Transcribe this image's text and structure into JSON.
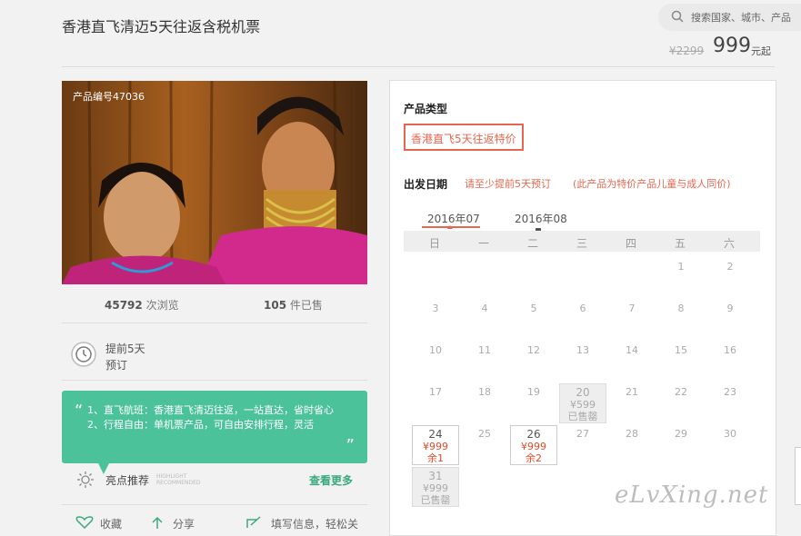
{
  "product": {
    "title": "香港直飞清迈5天往返含税机票",
    "old_price": "¥2299",
    "price": "999",
    "price_unit": "元起",
    "id_label": "产品编号47036"
  },
  "search": {
    "placeholder": "搜索国家、城市、产品"
  },
  "stats": {
    "views": "45792",
    "views_label": "次浏览",
    "sold": "105",
    "sold_label": "件已售"
  },
  "advance": {
    "line1": "提前5天",
    "line2": "预订"
  },
  "highlight": {
    "text1": "1、直飞航班：香港直飞清迈往返，一站直达，省时省心",
    "text2": "2、行程自由：单机票产品，可自由安排行程，灵活",
    "label": "亮点推荐",
    "label_en1": "HIGHLIGHT",
    "label_en2": "RECOMMENDED",
    "more": "查看更多"
  },
  "actions": [
    "收藏",
    "分享",
    "填写信息，轻松关"
  ],
  "booking": {
    "type_heading": "产品类型",
    "type_option": "香港直飞5天往返特价",
    "date_heading": "出发日期",
    "note1": "请至少提前5天预订",
    "note2": "(此产品为特价产品儿童与成人同价)",
    "months": [
      "2016年07",
      "2016年08"
    ],
    "weekdays": [
      "日",
      "一",
      "二",
      "三",
      "四",
      "五",
      "六"
    ],
    "days": [
      [
        "",
        "",
        "",
        "",
        "",
        "1",
        "2"
      ],
      [
        "3",
        "4",
        "5",
        "6",
        "7",
        "8",
        "9"
      ],
      [
        "10",
        "11",
        "12",
        "13",
        "14",
        "15",
        "16"
      ],
      [
        "17",
        "18",
        "19",
        "",
        "21",
        "22",
        "23"
      ],
      [
        "",
        "25",
        "",
        "27",
        "28",
        "29",
        "30"
      ]
    ],
    "cells": {
      "d20": {
        "day": "20",
        "price": "¥599",
        "status": "已售罄"
      },
      "d24": {
        "day": "24",
        "price": "¥999",
        "status": "余1"
      },
      "d26": {
        "day": "26",
        "price": "¥999",
        "status": "余2"
      },
      "d31": {
        "day": "31",
        "price": "¥999",
        "status": "已售罄"
      }
    }
  },
  "watermark": "eLvXing.net",
  "colors": {
    "accent": "#e6674f",
    "green": "#4cc29a",
    "price_red": "#e14b2b"
  }
}
